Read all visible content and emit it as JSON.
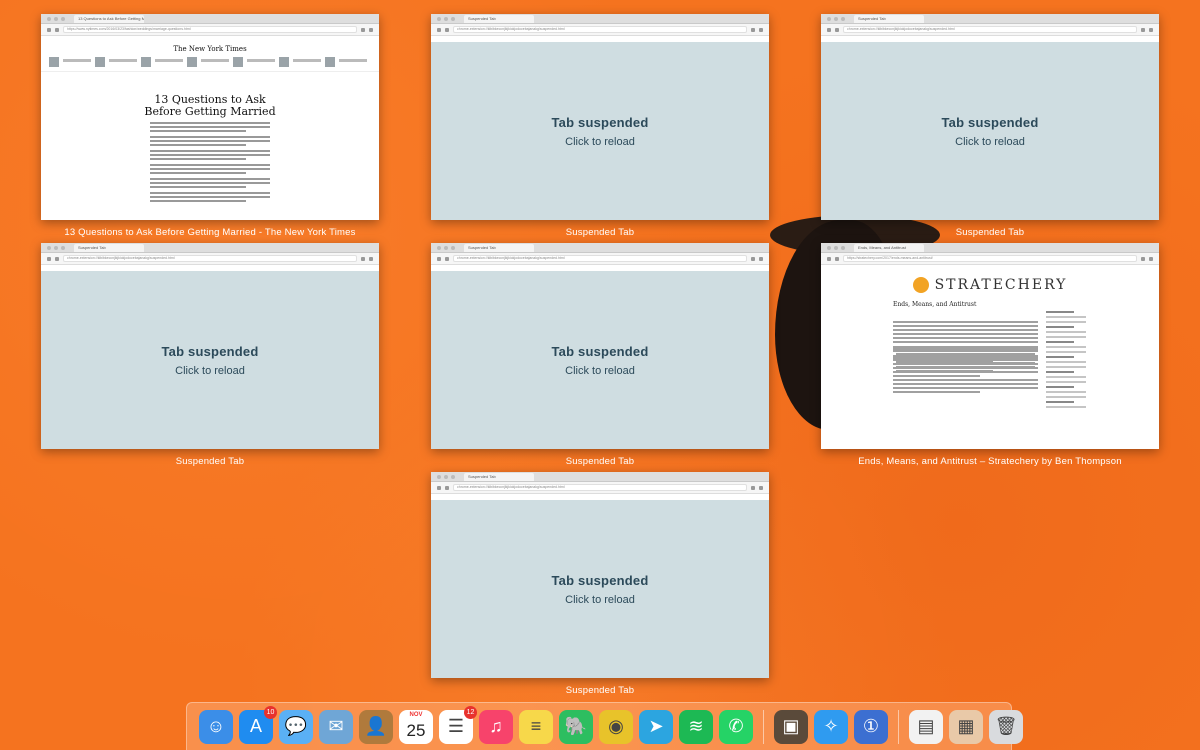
{
  "thumbnails": [
    {
      "kind": "nyt",
      "tab_title": "13 Questions to Ask Before Getting Married",
      "url": "https://www.nytimes.com/2016/03/23/fashion/weddings/marriage-questions.html",
      "caption": "13 Questions to Ask Before Getting Married - The New York Times",
      "masthead": "The New York Times",
      "headline": "13 Questions to Ask Before Getting Married"
    },
    {
      "kind": "suspended",
      "tab_title": "Suspended Tab",
      "url": "chrome-extension://klbibkeccnjlkjkiokjodocebajanakg/suspended.html",
      "caption": "Suspended Tab"
    },
    {
      "kind": "suspended",
      "tab_title": "Suspended Tab",
      "url": "chrome-extension://klbibkeccnjlkjkiokjodocebajanakg/suspended.html",
      "caption": "Suspended Tab"
    },
    {
      "kind": "suspended",
      "tab_title": "Suspended Tab",
      "url": "chrome-extension://klbibkeccnjlkjkiokjodocebajanakg/suspended.html",
      "caption": "Suspended Tab"
    },
    {
      "kind": "suspended",
      "tab_title": "Suspended Tab",
      "url": "chrome-extension://klbibkeccnjlkjkiokjodocebajanakg/suspended.html",
      "caption": "Suspended Tab"
    },
    {
      "kind": "strat",
      "tab_title": "Ends, Means, and Antitrust",
      "url": "https://stratechery.com/2017/ends-means-and-antitrust/",
      "caption": "Ends, Means, and Antitrust – Stratechery by Ben Thompson",
      "logo": "STRATECHERY",
      "headline": "Ends, Means, and Antitrust"
    },
    {
      "kind": "suspended",
      "tab_title": "Suspended Tab",
      "url": "chrome-extension://klbibkeccnjlkjkiokjodocebajanakg/suspended.html",
      "caption": "Suspended Tab"
    }
  ],
  "suspended": {
    "title": "Tab suspended",
    "subtitle": "Click to reload"
  },
  "dock": {
    "items": [
      {
        "name": "finder-icon",
        "color": "#3b8ee8",
        "glyph": "☺"
      },
      {
        "name": "app-store-icon",
        "color": "#1f8cf0",
        "glyph": "A",
        "badge": "10"
      },
      {
        "name": "messages-icon",
        "color": "#5ab0f5",
        "glyph": "💬"
      },
      {
        "name": "mail-icon",
        "color": "#6fa6d6",
        "glyph": "✉"
      },
      {
        "name": "contacts-icon",
        "color": "#b07a3c",
        "glyph": "👤"
      },
      {
        "name": "calendar-icon",
        "color": "#ffffff",
        "month": "NOV",
        "day": "25"
      },
      {
        "name": "reminders-icon",
        "color": "#ffffff",
        "glyph": "☰",
        "badge": "12"
      },
      {
        "name": "music-icon",
        "color": "#f7436b",
        "glyph": "♫"
      },
      {
        "name": "notes-icon",
        "color": "#f7d84a",
        "glyph": "≡"
      },
      {
        "name": "evernote-icon",
        "color": "#2dbe60",
        "glyph": "🐘"
      },
      {
        "name": "chrome-icon",
        "color": "#e8c32a",
        "glyph": "◉"
      },
      {
        "name": "telegram-icon",
        "color": "#2ca5e0",
        "glyph": "➤"
      },
      {
        "name": "spotify-icon",
        "color": "#1db954",
        "glyph": "≋"
      },
      {
        "name": "whatsapp-icon",
        "color": "#25d366",
        "glyph": "✆"
      },
      {
        "sep": true
      },
      {
        "name": "robot-app-icon",
        "color": "#5a4a3a",
        "glyph": "▣"
      },
      {
        "name": "safari-icon",
        "color": "#2f9bf0",
        "glyph": "✧"
      },
      {
        "name": "1password-icon",
        "color": "#3c6fd1",
        "glyph": "①"
      },
      {
        "sep": true
      },
      {
        "name": "document-icon",
        "color": "#f2f2f2",
        "glyph": "▤"
      },
      {
        "name": "downloads-stack-icon",
        "color": "#e9c9a8",
        "glyph": "▦"
      },
      {
        "name": "trash-icon",
        "color": "#d9dbde",
        "glyph": "🗑"
      }
    ]
  }
}
